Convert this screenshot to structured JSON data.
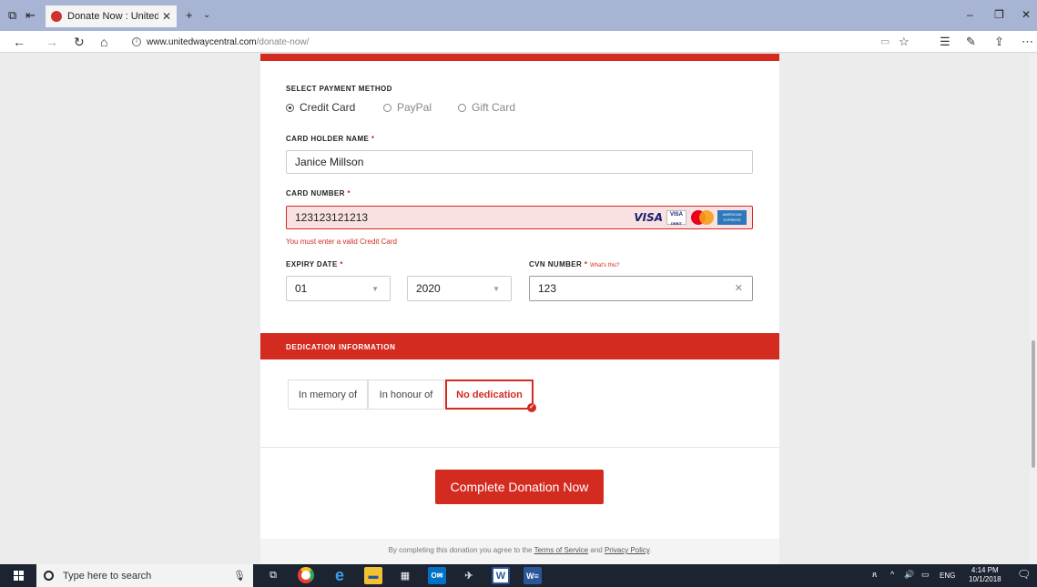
{
  "browser": {
    "tab_title": "Donate Now : United W",
    "url_domain": "www.unitedwaycentral.com",
    "url_path": "/donate-now/"
  },
  "payment": {
    "section_label": "SELECT PAYMENT METHOD",
    "methods": [
      {
        "label": "Credit Card",
        "selected": true
      },
      {
        "label": "PayPal",
        "selected": false
      },
      {
        "label": "Gift Card",
        "selected": false
      }
    ],
    "card_holder_label": "CARD HOLDER NAME",
    "card_holder_value": "Janice Millson",
    "card_number_label": "CARD NUMBER",
    "card_number_value": "123123121213",
    "card_error": "You must enter a valid Credit Card",
    "card_brands": {
      "visa": "VISA",
      "visa_debit": "VISA",
      "visa_debit_sub": "DEBIT",
      "amex_line1": "AMERICAN",
      "amex_line2": "EXPRESS"
    },
    "expiry_label": "EXPIRY DATE",
    "expiry_month": "01",
    "expiry_year": "2020",
    "cvn_label": "CVN NUMBER",
    "cvn_help": "What's this?",
    "cvn_value": "123",
    "required_marker": "*"
  },
  "dedication": {
    "heading": "DEDICATION INFORMATION",
    "options": [
      {
        "label": "In memory of",
        "selected": false
      },
      {
        "label": "In honour of",
        "selected": false
      },
      {
        "label": "No dedication",
        "selected": true
      }
    ]
  },
  "submit_label": "Complete Donation Now",
  "footer": {
    "prefix": "By completing this donation you agree to the",
    "terms": "Terms of Service",
    "and": "and",
    "privacy": "Privacy Policy",
    "suffix": "."
  },
  "taskbar": {
    "search_placeholder": "Type here to search",
    "language": "ENG",
    "time": "4:14 PM",
    "date": "10/1/2018"
  },
  "colors": {
    "accent": "#d42b21",
    "error_bg": "#f9e1e1",
    "taskbar": "#1c2331",
    "tabbar": "#a8b4d4"
  }
}
